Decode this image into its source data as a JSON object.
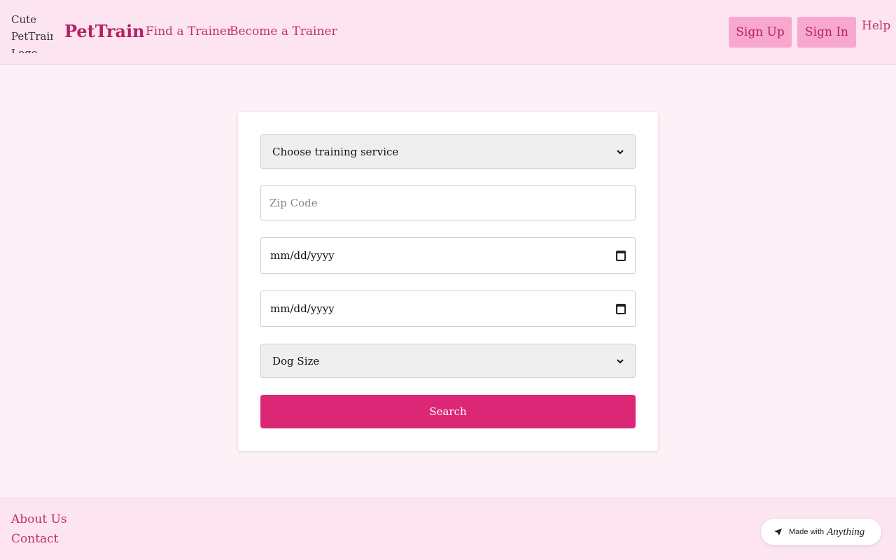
{
  "header": {
    "logo_alt": "Cute PetTrain Logo",
    "brand": "PetTrain",
    "nav": [
      "Find a Trainer",
      "Become a Trainer"
    ],
    "sign_up": "Sign Up",
    "sign_in": "Sign In",
    "help": "Help"
  },
  "form": {
    "service_select": "Choose training service",
    "zip_placeholder": "Zip Code",
    "start_date": "mm/dd/yyyy",
    "end_date": "mm/dd/yyyy",
    "dog_size_select": "Dog Size",
    "search_label": "Search"
  },
  "footer": {
    "about": "About Us",
    "contact": "Contact",
    "badge_prefix": "Made with",
    "badge_brand": "Anything"
  },
  "colors": {
    "brand": "#b81f62",
    "accent": "#dc2776",
    "header_bg": "#fce4f0",
    "page_bg": "#fdf0f7"
  }
}
